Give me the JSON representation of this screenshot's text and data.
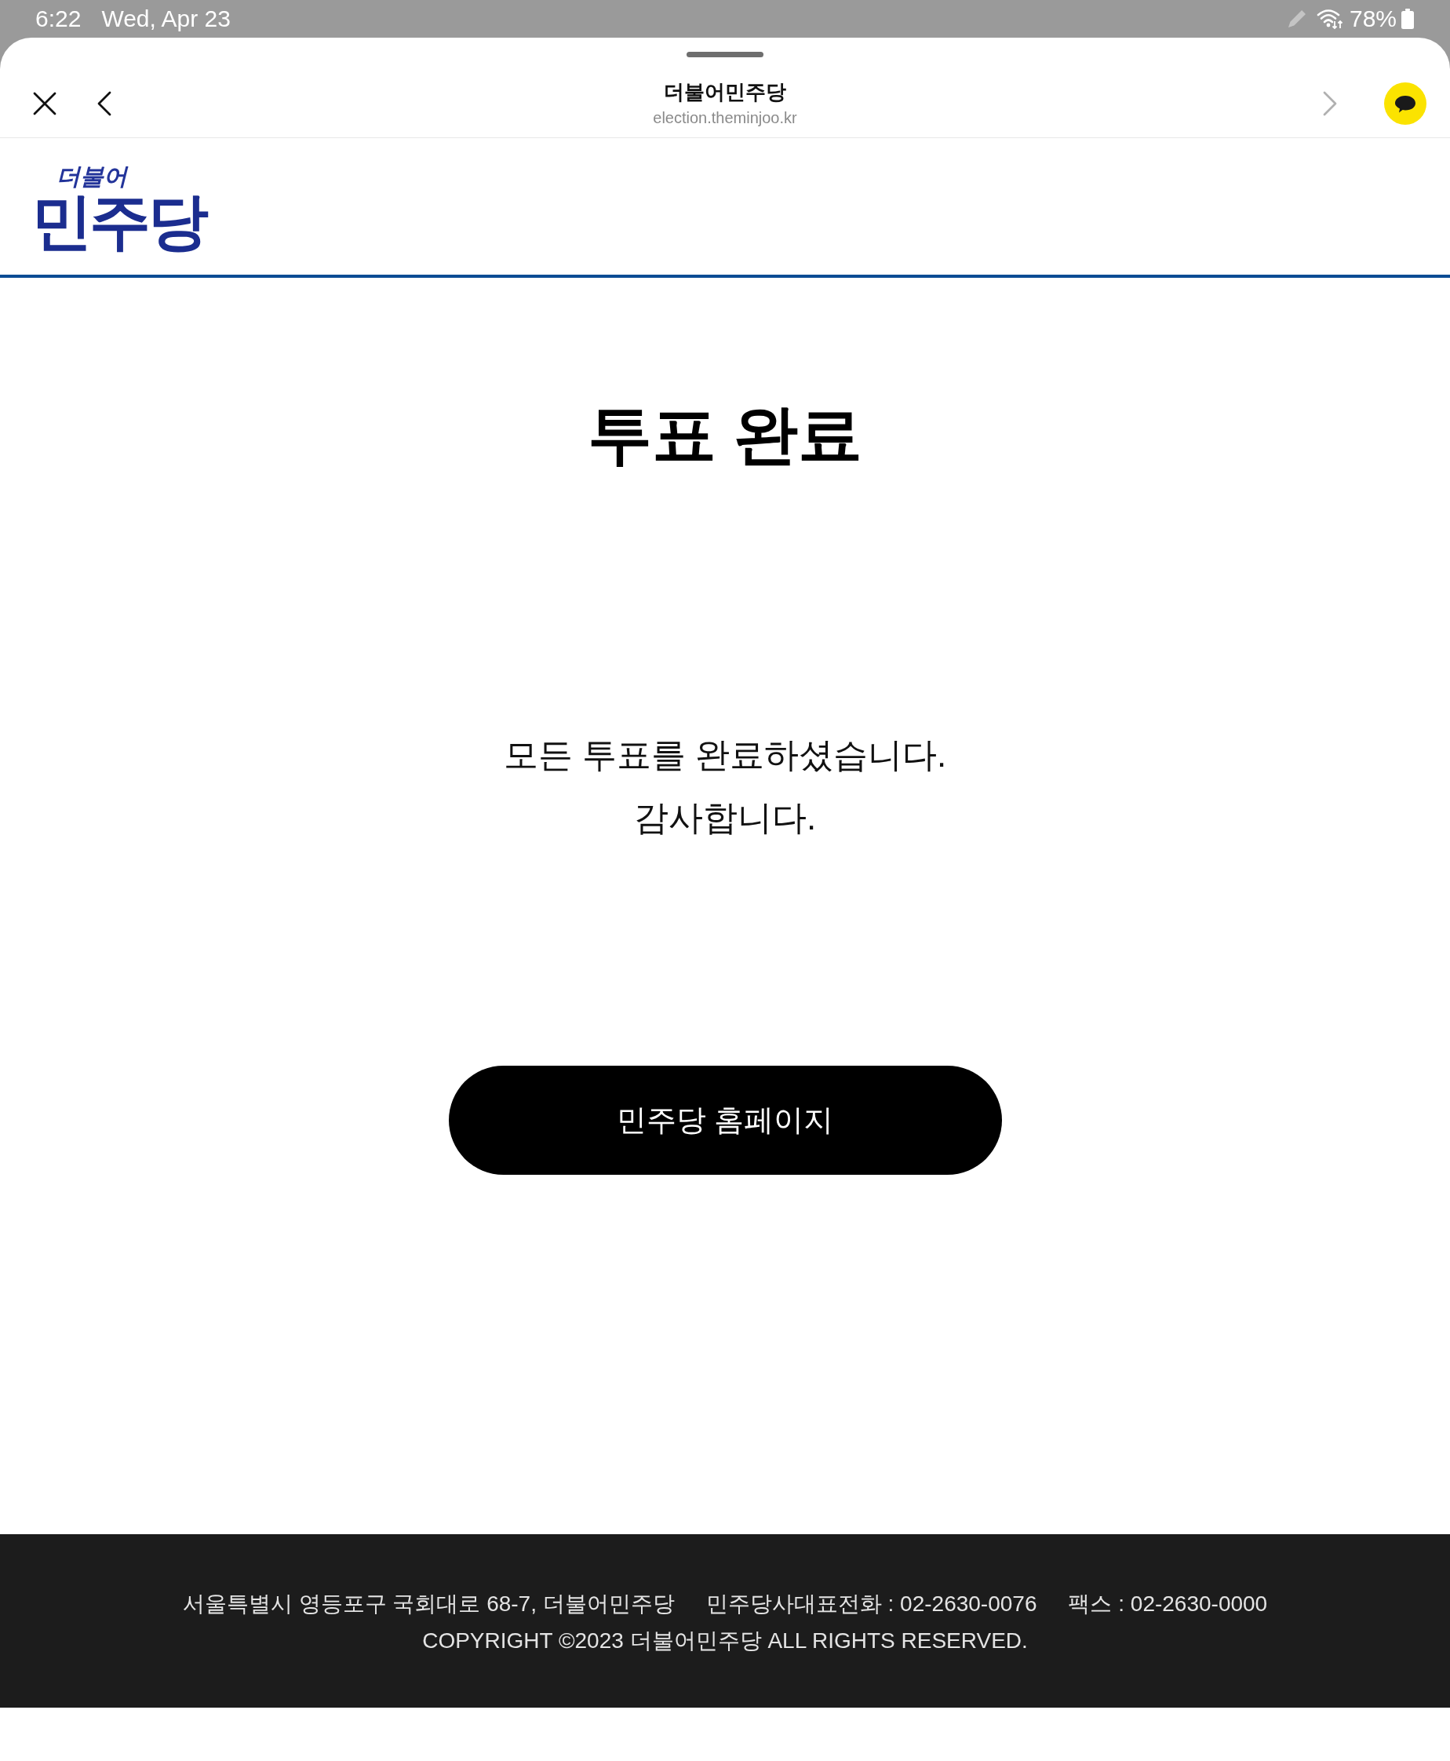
{
  "status_bar": {
    "time": "6:22",
    "date": "Wed, Apr 23",
    "battery": "78%"
  },
  "browser": {
    "title": "더불어민주당",
    "url": "election.theminjoo.kr",
    "back_disabled": false,
    "forward_disabled": true
  },
  "logo": {
    "small": "더불어",
    "large": "민주당"
  },
  "page": {
    "heading": "투표 완료",
    "message": [
      "모든 투표를 완료하셨습니다.",
      "감사합니다."
    ],
    "button": "민주당 홈페이지"
  },
  "footer": {
    "info": [
      "서울특별시 영등포구 국회대로 68-7, 더불어민주당",
      "민주당사대표전화 : 02-2630-0076",
      "팩스 : 02-2630-0000"
    ],
    "copyright": "COPYRIGHT ©2023 더불어민주당 ALL RIGHTS RESERVED."
  }
}
